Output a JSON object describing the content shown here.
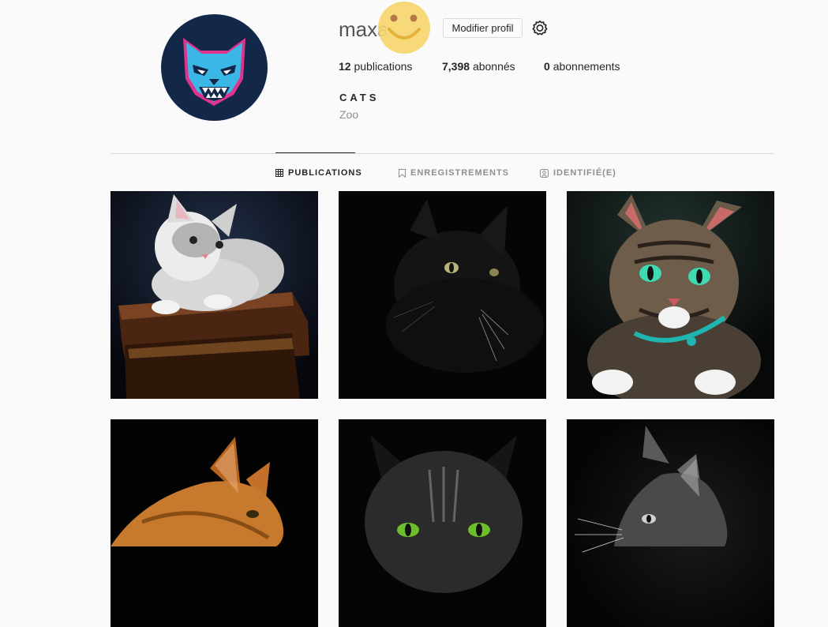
{
  "profile": {
    "username": "maxa",
    "edit_button": "Modifier profil",
    "stats": {
      "posts_count": "12",
      "posts_label": "publications",
      "followers_count": "7,398",
      "followers_label": "abonnés",
      "following_count": "0",
      "following_label": "abonnements"
    },
    "bio_name": "CATS",
    "bio_category": "Zoo"
  },
  "tabs": [
    {
      "label": "PUBLICATIONS",
      "icon": "grid-icon",
      "active": true
    },
    {
      "label": "ENREGISTREMENTS",
      "icon": "bookmark-icon",
      "active": false
    },
    {
      "label": "IDENTIFIÉ(E)",
      "icon": "tagged-icon",
      "active": false
    }
  ],
  "posts": [
    {
      "subject": "white-fluffy-kitten-on-books"
    },
    {
      "subject": "black-cat-in-shadow"
    },
    {
      "subject": "tabby-cat-green-eyes"
    },
    {
      "subject": "orange-cat-profile"
    },
    {
      "subject": "dark-tabby-green-eyes"
    },
    {
      "subject": "gray-cat-profile"
    }
  ],
  "colors": {
    "avatar_bg": "#132848",
    "avatar_cat": "#3bb7e6",
    "avatar_outline": "#e0338f",
    "smiley": "#f6d56a"
  }
}
